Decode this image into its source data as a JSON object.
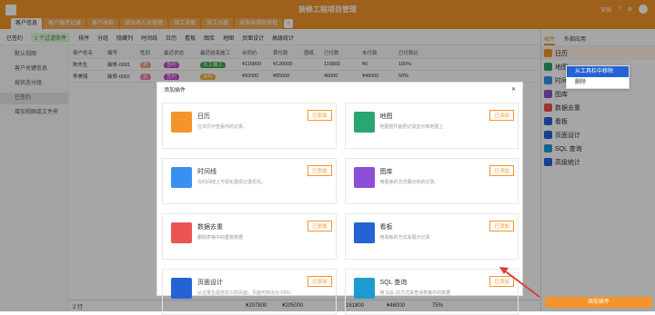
{
  "app": {
    "title": "装修工程项目管理",
    "user": "安佩",
    "tabs": [
      "客户信息",
      "客户跟进记录",
      "客户收款",
      "进出场人员管理",
      "施工进度",
      "施工付款",
      "采购申请和审批"
    ]
  },
  "toolbar": {
    "items": [
      "已签约",
      "1 个过滤条件",
      "排序",
      "分组",
      "隐藏列",
      "时间线",
      "日历",
      "看板",
      "图库",
      "地图",
      "页面设计",
      "高级统计"
    ]
  },
  "sidebar": {
    "views": [
      "默认视图",
      "客户关键信息",
      "按状态分组",
      "已签约",
      "增加视图或文件夹"
    ]
  },
  "grid": {
    "headers": [
      "客户姓名",
      "编号",
      "性别",
      "最近状态",
      "最近结束施工",
      "合同价",
      "首付款",
      "图纸",
      "已付款",
      "未付款",
      "已付款比"
    ],
    "rows": [
      [
        "陈先生",
        "装修-0001",
        "男",
        "签约",
        "木工施工",
        "¥115800",
        "¥120000",
        "",
        "115800",
        "¥0",
        "100%"
      ],
      [
        "李美丽",
        "装修-0002",
        "女",
        "签约",
        "涂料",
        "¥92000",
        "¥85000",
        "",
        "46000",
        "¥46000",
        "50%"
      ]
    ]
  },
  "footer": {
    "count": "2 行",
    "sum1": "¥207800",
    "sum2": "¥205000",
    "sum3": "161800",
    "sum4": "¥46000",
    "sum5": "75%"
  },
  "right": {
    "tabs": [
      "插件",
      "外部应用"
    ],
    "plugins": [
      "日历",
      "地图",
      "时间线",
      "图库",
      "数据去重",
      "看板",
      "页面设计",
      "SQL 查询",
      "高级统计"
    ],
    "menu": [
      "从工具栏中移除",
      "删除"
    ],
    "add": "添加插件"
  },
  "modal": {
    "title": "添加插件",
    "added": "已添加",
    "cards": [
      {
        "title": "日历",
        "desc": "在日历中查看你的记录。",
        "color": "#f3952a"
      },
      {
        "title": "地图",
        "desc": "地图插件能把记录显示到地图上",
        "color": "#2aa574"
      },
      {
        "title": "时间线",
        "desc": "在时间线上可视化展现记录优先。",
        "color": "#3b8ff0"
      },
      {
        "title": "图库",
        "desc": "用图库的方式展示你的记录。",
        "color": "#8c4fd6"
      },
      {
        "title": "数据去重",
        "desc": "删除表格中的重复数据",
        "color": "#ec5454"
      },
      {
        "title": "看板",
        "desc": "用看板的方式来展示记录",
        "color": "#2563d4"
      },
      {
        "title": "页面设计",
        "desc": "从记录生成自定义的页面，页面可转出为 PDF。",
        "color": "#2563d4"
      },
      {
        "title": "SQL 查询",
        "desc": "用 SQL 的方式来查询表格中的数据",
        "color": "#1d9bd1"
      }
    ]
  }
}
